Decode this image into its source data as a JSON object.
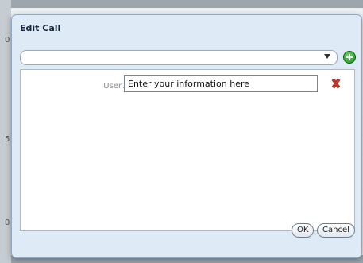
{
  "dialog": {
    "title": "Edit Call",
    "combo_value": "",
    "field": {
      "label": "User7 :",
      "value": "Enter your information here"
    },
    "buttons": {
      "ok": "OK",
      "cancel": "Cancel"
    },
    "icons": {
      "add": "plus-circle-icon",
      "delete": "delete-x-icon"
    }
  },
  "background": {
    "row_numbers": [
      "0",
      "5",
      "0"
    ]
  }
}
